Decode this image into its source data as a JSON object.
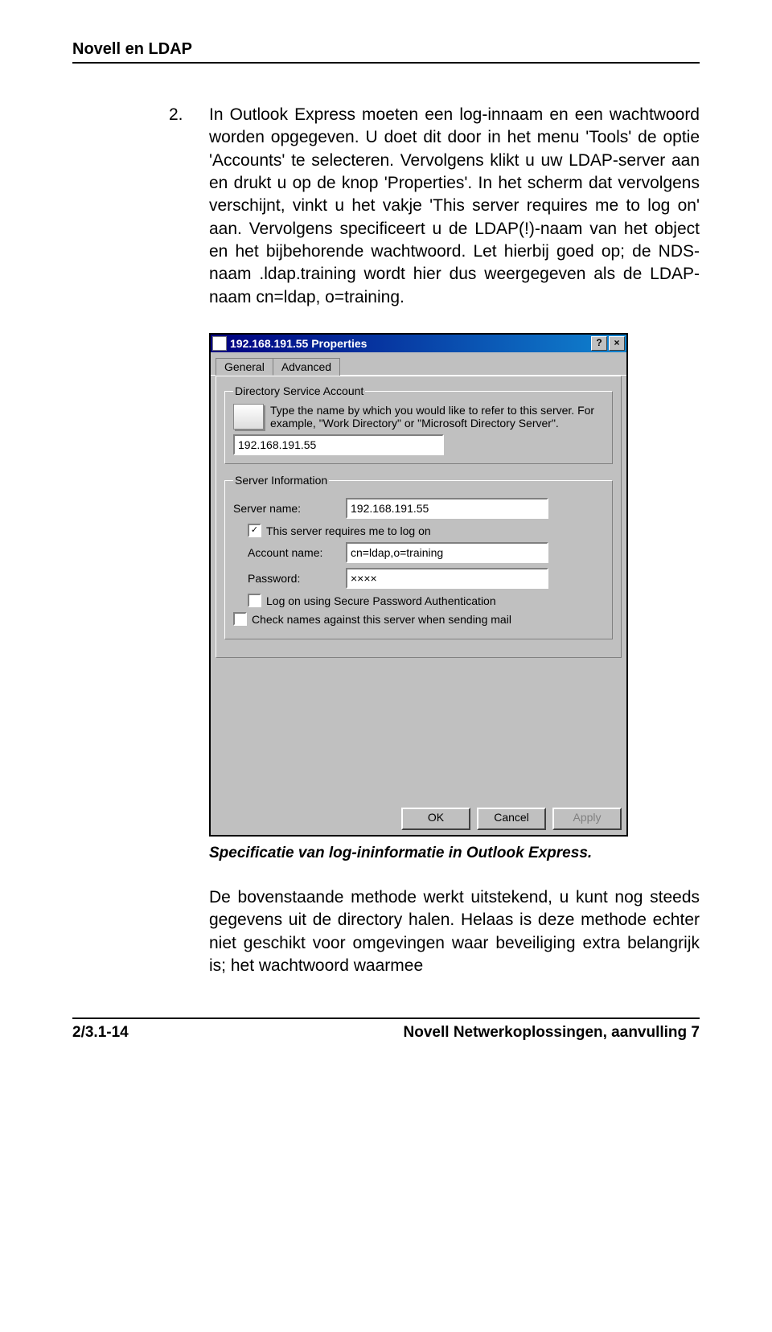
{
  "header": {
    "running_head": "Novell en LDAP"
  },
  "body": {
    "step_number": "2.",
    "step_text": "In Outlook Express moeten een log-innaam en een wachtwoord worden opgegeven. U doet dit door in het menu 'Tools' de optie 'Accounts' te selecteren. Vervolgens klikt u uw LDAP-server aan en drukt u op de knop 'Properties'. In het scherm dat vervolgens verschijnt, vinkt u het vakje 'This server requires me to log on' aan. Vervolgens specificeert u de LDAP(!)-naam van het object en het bijbehorende wachtwoord. Let hierbij goed op; de NDS-naam .ldap.training wordt hier dus weergegeven als de LDAP-naam cn=ldap, o=training."
  },
  "dialog": {
    "title": "192.168.191.55 Properties",
    "help_btn": "?",
    "close_btn": "×",
    "tabs": {
      "general": "General",
      "advanced": "Advanced"
    },
    "account": {
      "legend": "Directory Service Account",
      "hint": "Type the name by which you would like to refer to this server. For example, \"Work Directory\" or \"Microsoft Directory Server\".",
      "value": "192.168.191.55"
    },
    "server_info": {
      "legend": "Server Information",
      "server_name_label": "Server name:",
      "server_name_value": "192.168.191.55",
      "requires_logon_label": "This server requires me to log on",
      "requires_logon_checked": "✓",
      "account_name_label": "Account name:",
      "account_name_value": "cn=ldap,o=training",
      "password_label": "Password:",
      "password_value": "××××",
      "spa_label": "Log on using Secure Password Authentication",
      "check_names_label": "Check names against this server when sending mail"
    },
    "buttons": {
      "ok": "OK",
      "cancel": "Cancel",
      "apply": "Apply"
    }
  },
  "caption": "Specificatie van log-ininformatie in Outlook Express.",
  "para2": "De bovenstaande methode werkt uitstekend, u kunt nog steeds gegevens uit de directory halen. Helaas is deze methode echter niet geschikt voor omgevingen waar beveiliging extra belangrijk is; het wachtwoord waarmee",
  "footer": {
    "left": "2/3.1-14",
    "right": "Novell Netwerkoplossingen, aanvulling 7"
  }
}
